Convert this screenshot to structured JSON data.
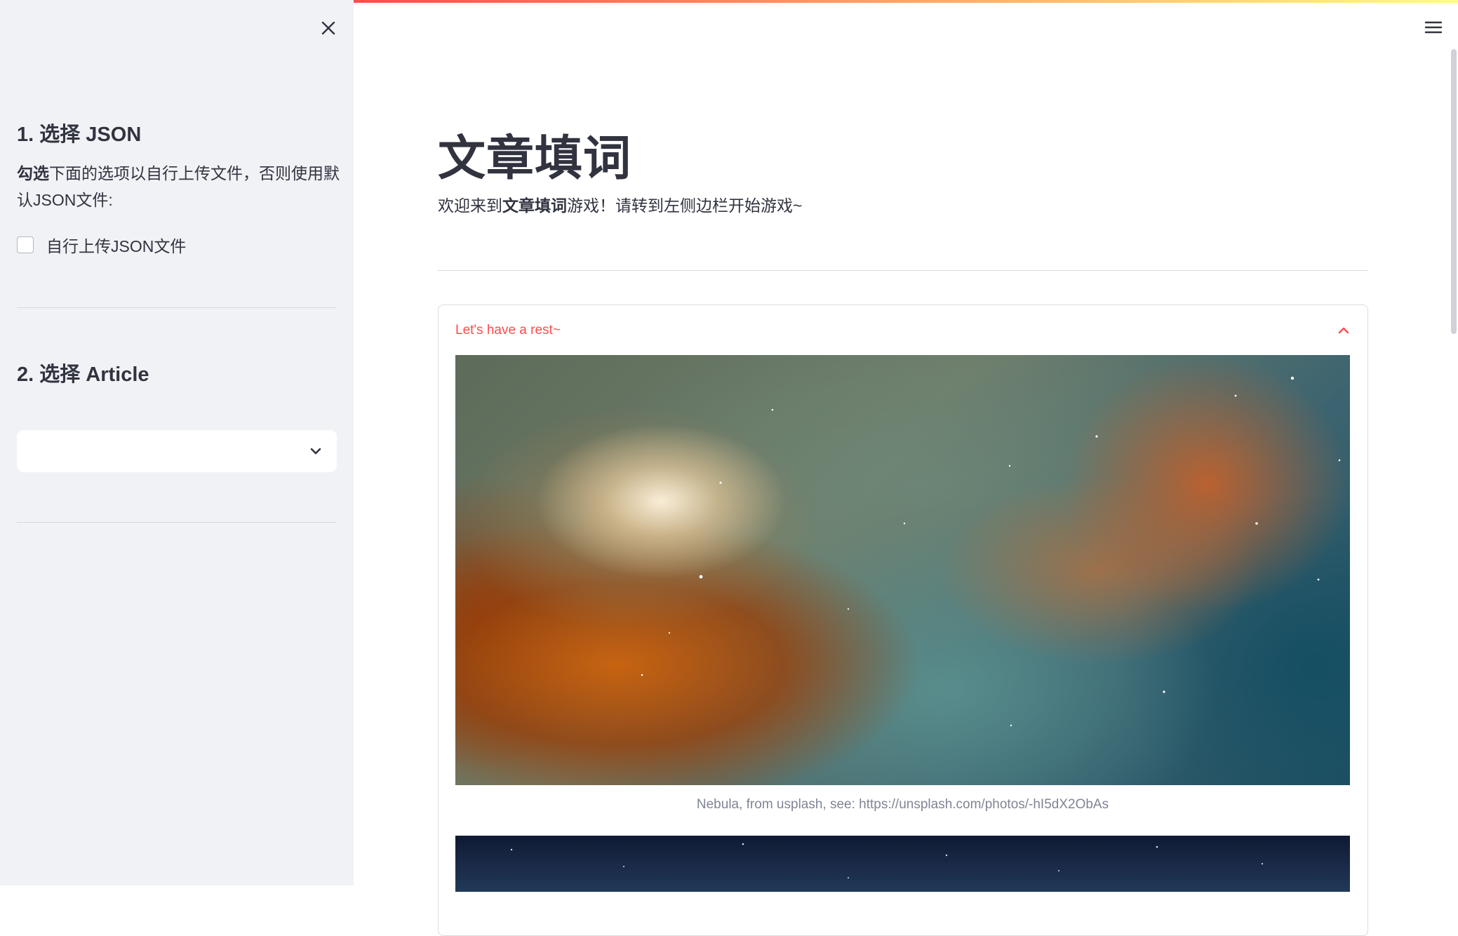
{
  "sidebar": {
    "section1_title": "1. 选择 JSON",
    "description_bold": "勾选",
    "description_rest": "下面的选项以自行上传文件，否则使用默认JSON文件:",
    "checkbox_label": "自行上传JSON文件",
    "checkbox_checked": false,
    "section2_title": "2. 选择 Article",
    "select_value": ""
  },
  "main": {
    "title": "文章填词",
    "intro_pre": "欢迎来到",
    "intro_bold": "文章填词",
    "intro_post": "游戏！请转到左侧边栏开始游戏~",
    "expander_title": "Let's have a rest~",
    "expander_expanded": true,
    "image_caption": "Nebula, from usplash, see: https://unsplash.com/photos/-hI5dX2ObAs"
  },
  "icons": {
    "close": "close-icon",
    "menu": "hamburger-menu-icon",
    "select_chevron": "chevron-down-icon",
    "expander_chevron": "chevron-up-icon"
  },
  "colors": {
    "accent": "#ff4b4b",
    "sidebar_bg": "#f0f2f6",
    "text": "#31333f",
    "caption": "#808495"
  }
}
